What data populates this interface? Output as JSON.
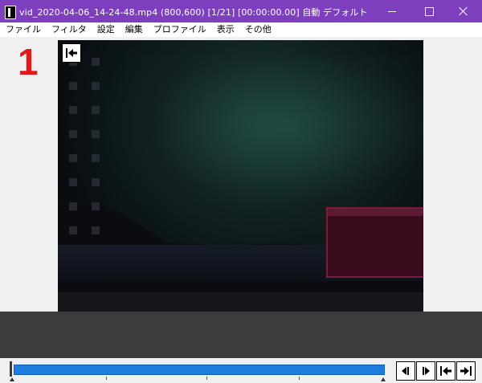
{
  "window": {
    "title": "vid_2020-04-06_14-24-48.mp4 (800,600)  [1/21] [00:00:00.00]  自動  デフォルト",
    "title_bar_color": "#7d3fbe",
    "icons": [
      "app-icon",
      "minimize-icon",
      "maximize-icon",
      "close-icon"
    ]
  },
  "menu": {
    "items": [
      "ファイル",
      "フィルタ",
      "設定",
      "編集",
      "プロファイル",
      "表示",
      "その他"
    ]
  },
  "preview": {
    "frame_number": "1",
    "frame_number_color": "#e01a1a",
    "overlay_icon": "jump-to-start-icon"
  },
  "seekbar": {
    "position_fraction": 0.0,
    "fill_color": "#1e7ee0"
  },
  "controls": {
    "buttons": [
      "prev-frame-icon",
      "next-frame-icon",
      "skip-first-icon",
      "skip-last-icon"
    ]
  }
}
